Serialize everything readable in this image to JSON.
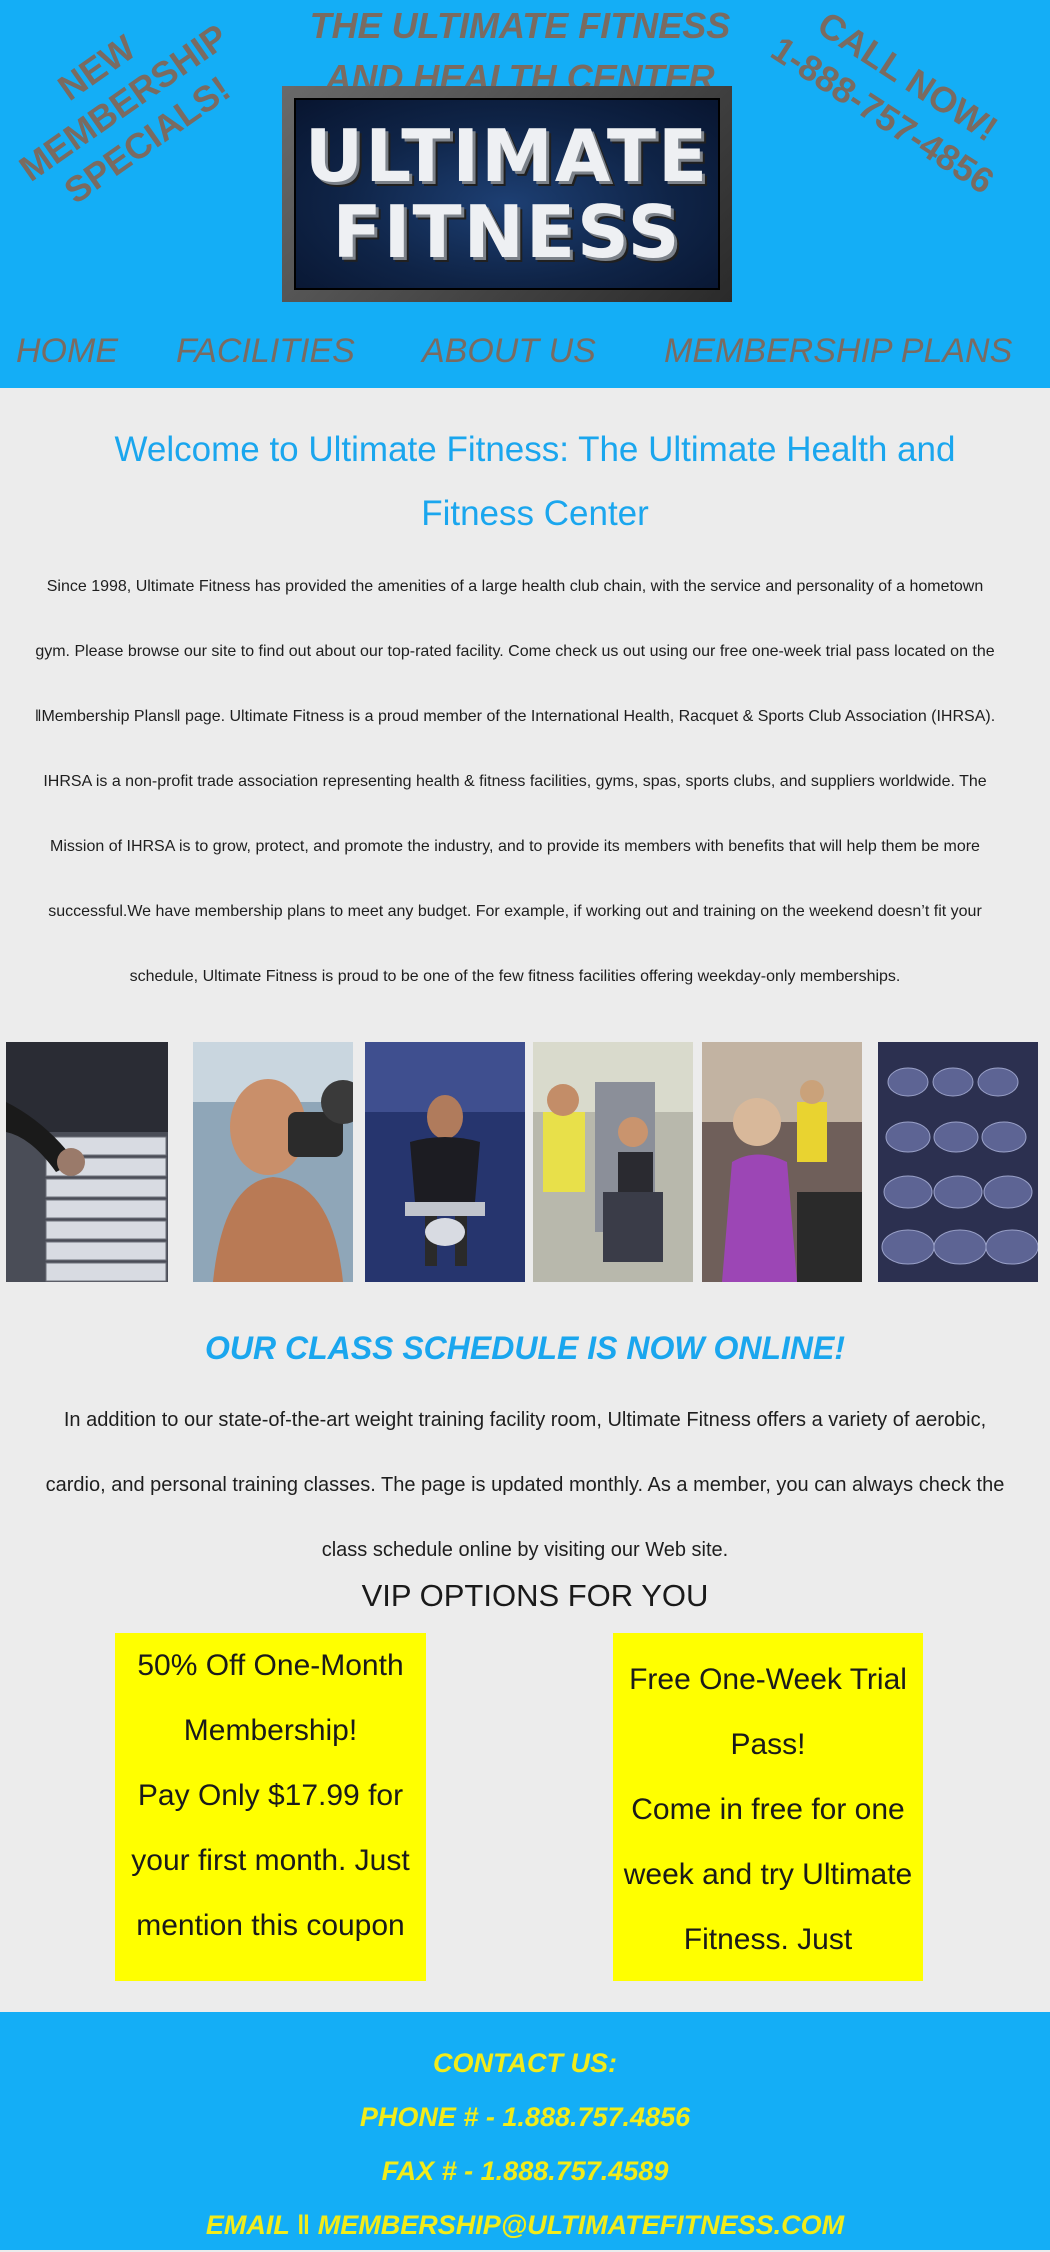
{
  "header": {
    "promo_left": [
      "NEW",
      "MEMBERSHIP",
      "SPECIALS!"
    ],
    "title_lines": [
      "THE ULTIMATE FITNESS",
      "AND HEALTH CENTER"
    ],
    "logo_lines": [
      "ULTIMATE",
      "FITNESS"
    ],
    "promo_right": [
      "CALL NOW!",
      "1-888-757-4856"
    ]
  },
  "nav": {
    "items": [
      "HOME",
      "FACILITIES",
      "ABOUT US",
      "MEMBERSHIP PLANS"
    ]
  },
  "welcome": {
    "heading": "Welcome to Ultimate Fitness: The Ultimate Health and Fitness Center",
    "body": "Since 1998, Ultimate Fitness has provided the amenities of a large health club chain, with the service and personality of a hometown gym. Please browse our site to find out about our top-rated facility. Come check us out using our free one-week trial pass located on the ‖Membership Plans‖ page. Ultimate Fitness is a proud member of the International Health, Racquet & Sports Club Association (IHRSA). IHRSA is a non-profit trade association representing health & fitness facilities, gyms, spas, sports clubs, and suppliers worldwide. The Mission of IHRSA is to grow, protect, and promote the industry, and to provide its members with benefits that will help them be more successful.We have membership plans to meet any budget. For example, if working out and training on the weekend doesn’t fit your schedule, Ultimate Fitness is proud to be one of the few fitness facilities offering weekday-only memberships."
  },
  "photos": [
    "weight-stack-photo",
    "man-lifting-dumbbell-photo",
    "man-seated-curl-photo",
    "couple-machine-photo",
    "woman-cardio-photo",
    "dumbbell-rack-photo"
  ],
  "classes": {
    "heading": "OUR CLASS SCHEDULE IS NOW ONLINE!",
    "body": "In addition to our state-of-the-art weight training facility room, Ultimate Fitness offers a variety of aerobic, cardio, and personal training classes. The page is updated monthly. As a member, you can always check the class schedule online by visiting our Web site."
  },
  "vip": {
    "heading": "VIP OPTIONS FOR YOU",
    "coupon1": "50% Off One-Month Membership!\nPay Only $17.99 for your first month. Just mention this coupon",
    "coupon2": "Free One-Week Trial Pass!\nCome in free for one week and try Ultimate Fitness. Just"
  },
  "footer": {
    "contact_label": "CONTACT US:",
    "phone": "PHONE # - 1.888.757.4856",
    "fax": "FAX # - 1.888.757.4589",
    "email": "EMAIL ‖ MEMBERSHIP@ULTIMATEFITNESS.COM"
  },
  "colors": {
    "brand_blue": "#14aef6",
    "heading_blue": "#1aa6ee",
    "promo_gray": "#7a6b61",
    "coupon_yellow": "#ffff00",
    "footer_text": "#f2ec1a"
  }
}
